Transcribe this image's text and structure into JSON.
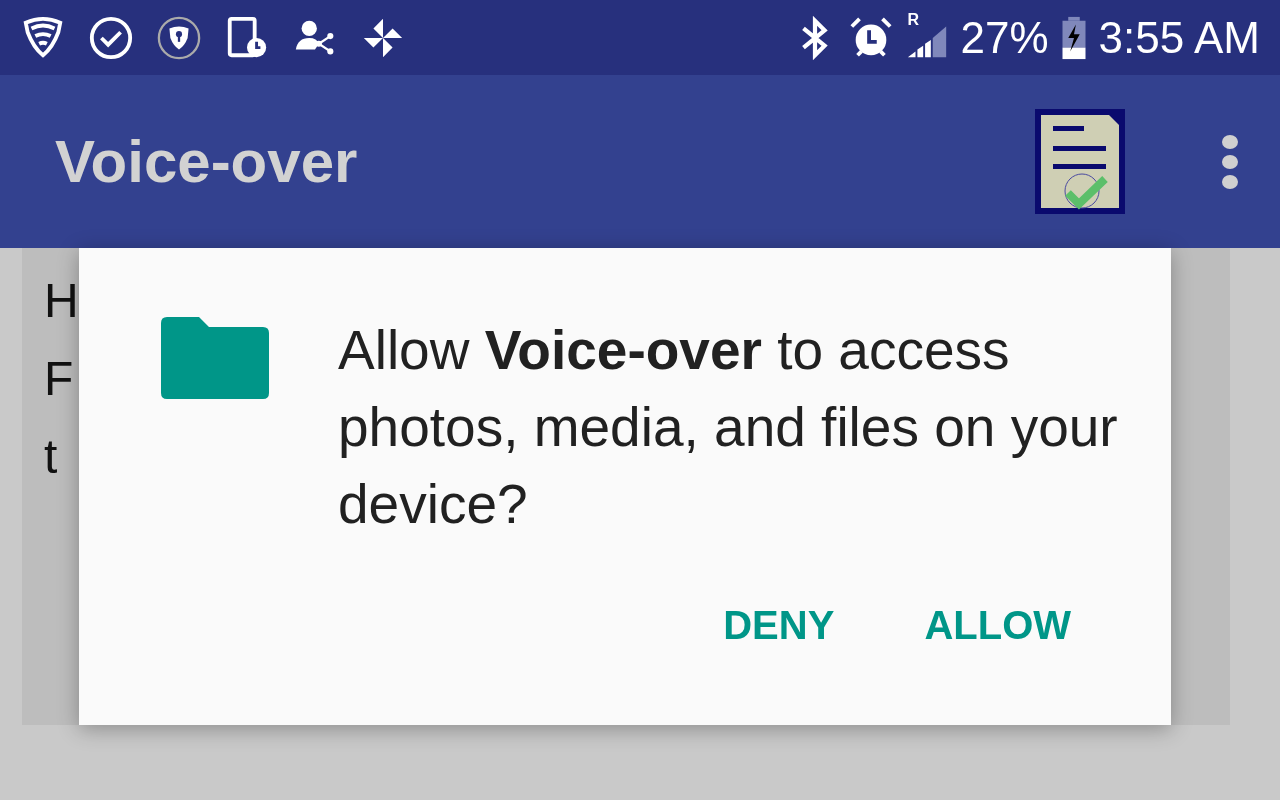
{
  "status_bar": {
    "roaming_label": "R",
    "battery_percent": "27%",
    "time": "3:55 AM"
  },
  "app_bar": {
    "title": "Voice-over"
  },
  "background_text": [
    "H",
    "F",
    "t"
  ],
  "dialog": {
    "message": "Allow **Voice-over** to access photos, media, and files on your device?",
    "buttons": [
      {
        "label": "DENY"
      },
      {
        "label": "ALLOW"
      }
    ]
  }
}
